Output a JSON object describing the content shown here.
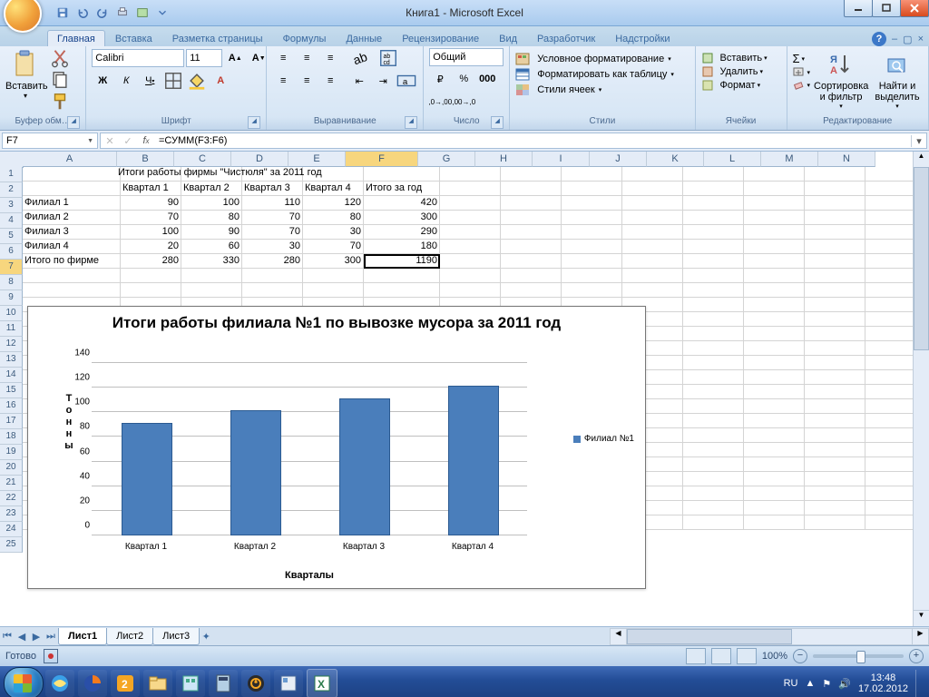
{
  "window": {
    "title": "Книга1 - Microsoft Excel"
  },
  "tabs": [
    "Главная",
    "Вставка",
    "Разметка страницы",
    "Формулы",
    "Данные",
    "Рецензирование",
    "Вид",
    "Разработчик",
    "Надстройки"
  ],
  "active_tab": 0,
  "ribbon": {
    "clipboard": {
      "label": "Буфер обм…",
      "paste": "Вставить"
    },
    "font": {
      "label": "Шрифт",
      "name": "Calibri",
      "size": "11"
    },
    "align": {
      "label": "Выравнивание"
    },
    "number": {
      "label": "Число",
      "format": "Общий"
    },
    "styles": {
      "label": "Стили",
      "cond": "Условное форматирование",
      "table": "Форматировать как таблицу",
      "cells": "Стили ячеек"
    },
    "cells_grp": {
      "label": "Ячейки",
      "insert": "Вставить",
      "delete": "Удалить",
      "format": "Формат"
    },
    "editing": {
      "label": "Редактирование",
      "sort": "Сортировка и фильтр",
      "find": "Найти и выделить"
    }
  },
  "namebox": "F7",
  "formula": "=СУММ(F3:F6)",
  "columns": [
    "A",
    "B",
    "C",
    "D",
    "E",
    "F",
    "G",
    "H",
    "I",
    "J",
    "K",
    "L",
    "M",
    "N"
  ],
  "rows_visible": 25,
  "active_cell": {
    "row": 7,
    "col": "F"
  },
  "sheet": {
    "title_row": "Итоги работы фирмы \"Чистюля\" за 2011 год",
    "headers": [
      "",
      "Квартал 1",
      "Квартал 2",
      "Квартал 3",
      "Квартал 4",
      "Итого за год"
    ],
    "data": [
      [
        "Филиал 1",
        90,
        100,
        110,
        120,
        420
      ],
      [
        "Филиал 2",
        70,
        80,
        70,
        80,
        300
      ],
      [
        "Филиал 3",
        100,
        90,
        70,
        30,
        290
      ],
      [
        "Филиал 4",
        20,
        60,
        30,
        70,
        180
      ],
      [
        "Итого по фирме",
        280,
        330,
        280,
        300,
        1190
      ]
    ]
  },
  "chart_data": {
    "type": "bar",
    "title": "Итоги работы филиала №1 по вывозке мусора за 2011 год",
    "categories": [
      "Квартал 1",
      "Квартал 2",
      "Квартал 3",
      "Квартал 4"
    ],
    "series": [
      {
        "name": "Филиал №1",
        "values": [
          90,
          100,
          110,
          120
        ]
      }
    ],
    "xlabel": "Кварталы",
    "ylabel": "Тонны",
    "ylim": [
      0,
      140
    ],
    "ystep": 20
  },
  "sheets": [
    "Лист1",
    "Лист2",
    "Лист3"
  ],
  "active_sheet": 0,
  "status": {
    "ready": "Готово",
    "zoom": "100%",
    "lang": "RU",
    "time": "13:48",
    "date": "17.02.2012"
  }
}
